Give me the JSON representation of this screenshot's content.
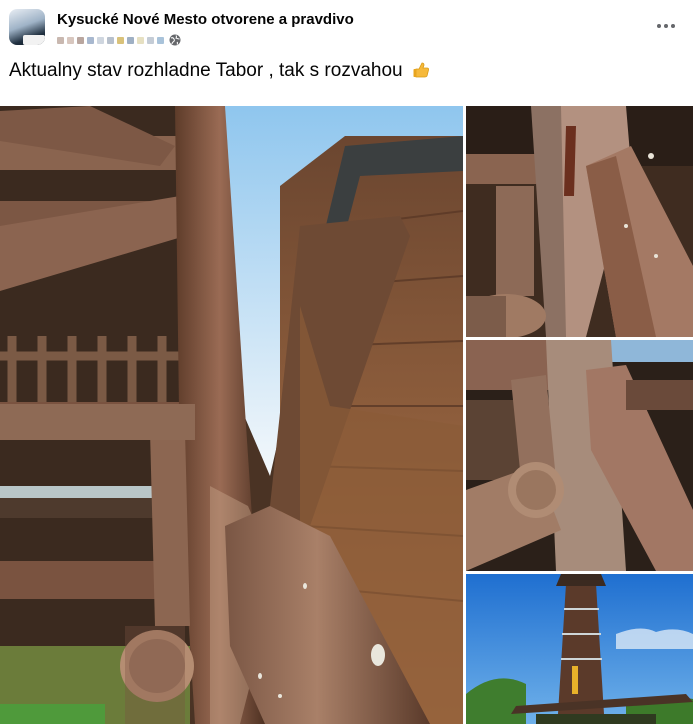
{
  "post": {
    "group_name": "Kysucké Nové Mesto otvorene a pravdivo",
    "text": "Aktualny stav rozhladne Tabor , tak s rozvahou",
    "emoji_icon": "thumbs-up-icon",
    "privacy_icon": "globe-icon",
    "more_icon": "more-horizontal-icon"
  },
  "gallery": {
    "photo_count": 4,
    "photos": [
      {
        "subject": "wooden-log-column-damage"
      },
      {
        "subject": "cracked-log-junction"
      },
      {
        "subject": "log-joint-detail"
      },
      {
        "subject": "observation-tower-exterior"
      }
    ]
  },
  "colors": {
    "text_primary": "#050505",
    "text_secondary": "#65676b",
    "wood_dark": "#6e4a33",
    "wood_light": "#9a6b4e",
    "sky_blue": "#2f7fd6"
  }
}
